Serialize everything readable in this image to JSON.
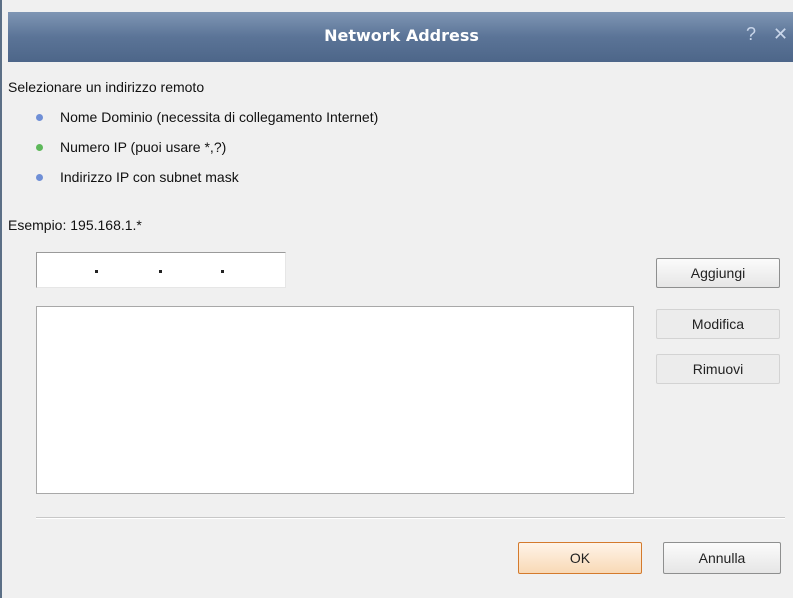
{
  "window": {
    "title": "Network Address",
    "help_glyph": "?",
    "close_glyph": "✕"
  },
  "heading": "Selezionare un indirizzo remoto",
  "options": [
    {
      "label": "Nome Dominio (necessita di collegamento Internet)",
      "color": "#6f8fd6",
      "selected": false
    },
    {
      "label": "Numero IP (puoi usare *,?)",
      "color": "#5db85a",
      "selected": true
    },
    {
      "label": "Indirizzo IP con subnet mask",
      "color": "#6f8fd6",
      "selected": false
    }
  ],
  "example": "Esempio: 195.168.1.*",
  "ip_input": {
    "value": ""
  },
  "buttons": {
    "add": "Aggiungi",
    "edit": "Modifica",
    "remove": "Rimuovi",
    "ok": "OK",
    "cancel": "Annulla"
  },
  "colors": {
    "titlebar": "#5b7497",
    "ok_border": "#d47a2c"
  }
}
